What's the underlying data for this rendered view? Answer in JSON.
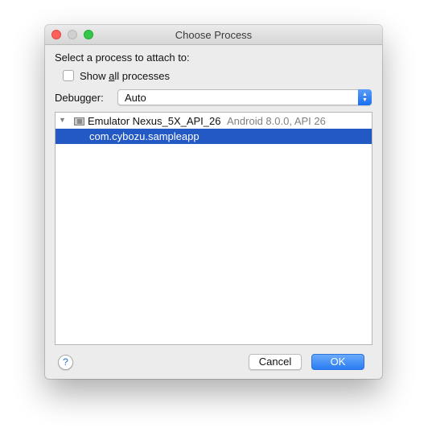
{
  "window": {
    "title": "Choose Process"
  },
  "prompt": "Select a process to attach to:",
  "show_all": {
    "label_before": "Show ",
    "label_mnemonic": "a",
    "label_after": "ll processes",
    "checked": false
  },
  "debugger": {
    "label": "Debugger:",
    "value": "Auto"
  },
  "tree": {
    "device": {
      "name": "Emulator Nexus_5X_API_26",
      "info": "Android 8.0.0, API 26",
      "expanded": true
    },
    "processes": [
      {
        "name": "com.cybozu.sampleapp",
        "selected": true
      }
    ]
  },
  "buttons": {
    "help": "?",
    "cancel": "Cancel",
    "ok": "OK"
  },
  "colors": {
    "selection": "#2359c4",
    "accent": "#2a7cf2"
  }
}
